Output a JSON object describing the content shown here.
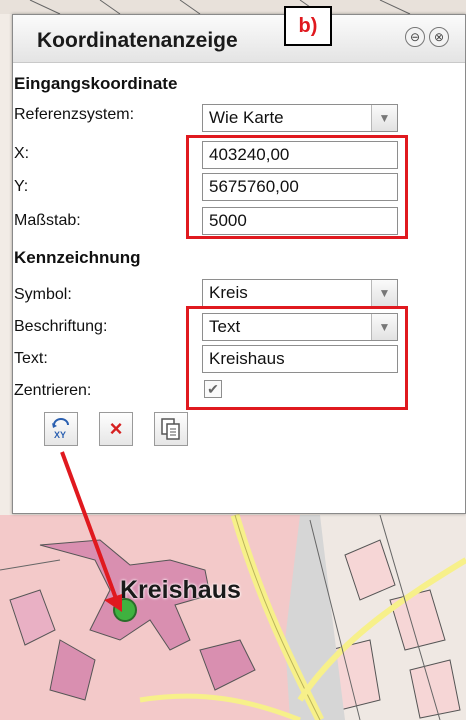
{
  "window": {
    "title": "Koordinatenanzeige",
    "annotation": "b)",
    "collapse_icon": "⊖",
    "close_icon": "⊗"
  },
  "eingang": {
    "heading": "Eingangskoordinate",
    "referenz_label": "Referenzsystem:",
    "referenz_value": "Wie Karte",
    "x_label": "X:",
    "x_value": "403240,00",
    "y_label": "Y:",
    "y_value": "5675760,00",
    "massstab_label": "Maßstab:",
    "massstab_value": "5000"
  },
  "kennzeichnung": {
    "heading": "Kennzeichnung",
    "symbol_label": "Symbol:",
    "symbol_value": "Kreis",
    "beschriftung_label": "Beschriftung:",
    "beschriftung_value": "Text",
    "text_label": "Text:",
    "text_value": "Kreishaus",
    "zentrieren_label": "Zentrieren:",
    "zentrieren_checked": true
  },
  "toolbar": {
    "locate_icon_text": "XY",
    "clear_icon_text": "×",
    "copy_icon": "copy-icon"
  },
  "map": {
    "label": "Kreishaus",
    "marker_color": "#3fb23f"
  },
  "colors": {
    "highlight": "#e0191f",
    "arrow": "#e0191f"
  }
}
